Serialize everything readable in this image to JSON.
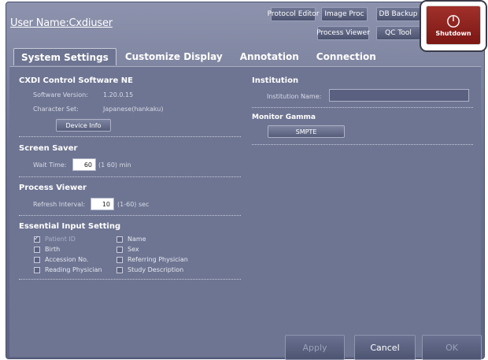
{
  "header": {
    "user_name": "User Name:Cxdiuser",
    "buttons": {
      "protocol_editor": "Protocol Editor",
      "image_proc": "Image Proc",
      "db_backup": "DB Backup",
      "process_viewer": "Process Viewer",
      "qc_tool": "QC Tool",
      "shutdown": "Shutdown"
    },
    "shutdown_icon": "power-icon"
  },
  "tabs": [
    "System Settings",
    "Customize Display",
    "Annotation",
    "Connection"
  ],
  "active_tab": "System Settings",
  "left": {
    "cxdi": {
      "title": "CXDI Control Software NE",
      "software_version_label": "Software Version:",
      "software_version_value": "1.20.0.15",
      "character_set_label": "Character Set:",
      "character_set_value": "Japanese(hankaku)",
      "device_info_button": "Device Info"
    },
    "screen_saver": {
      "title": "Screen Saver",
      "wait_time_label": "Wait Time:",
      "wait_time_value": "60",
      "wait_time_range": "(1 60)  min"
    },
    "process_viewer": {
      "title": "Process Viewer",
      "refresh_label": "Refresh Interval:",
      "refresh_value": "10",
      "refresh_range": "(1-60)  sec"
    },
    "essential": {
      "title": "Essential Input Setting",
      "items": [
        {
          "label": "Patient ID",
          "checked": true,
          "disabled": true
        },
        {
          "label": "Name",
          "checked": false,
          "disabled": false
        },
        {
          "label": "Birth",
          "checked": false,
          "disabled": false
        },
        {
          "label": "Sex",
          "checked": false,
          "disabled": false
        },
        {
          "label": "Accession No.",
          "checked": false,
          "disabled": false
        },
        {
          "label": "Referring Physician",
          "checked": false,
          "disabled": false
        },
        {
          "label": "Reading Physician",
          "checked": false,
          "disabled": false
        },
        {
          "label": "Study Description",
          "checked": false,
          "disabled": false
        }
      ]
    }
  },
  "right": {
    "institution": {
      "title": "Institution",
      "name_label": "Institution Name:",
      "name_value": ""
    },
    "monitor_gamma": {
      "title": "Monitor Gamma",
      "value": "SMPTE"
    }
  },
  "footer": {
    "apply": "Apply",
    "cancel": "Cancel",
    "ok": "OK"
  },
  "colors": {
    "background": "#6e7592",
    "shutdown": "#8f221e"
  }
}
